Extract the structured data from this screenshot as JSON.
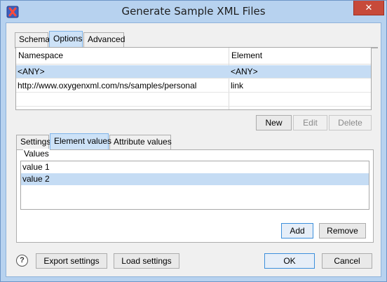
{
  "window": {
    "title": "Generate Sample XML Files",
    "close_glyph": "✕",
    "app_icon": "oxygen-x-icon"
  },
  "main_tabs": [
    {
      "label": "Schema",
      "active": false
    },
    {
      "label": "Options",
      "active": true
    },
    {
      "label": "Advanced",
      "active": false
    }
  ],
  "table": {
    "columns": [
      "Namespace",
      "Element"
    ],
    "rows": [
      {
        "namespace": "<ANY>",
        "element": "<ANY>",
        "selected": true
      },
      {
        "namespace": "http://www.oxygenxml.com/ns/samples/personal",
        "element": "link",
        "selected": false
      }
    ]
  },
  "table_buttons": {
    "new_label": "New",
    "edit_label": "Edit",
    "delete_label": "Delete"
  },
  "sub_tabs": [
    {
      "label": "Settings",
      "active": false
    },
    {
      "label": "Element values",
      "active": true
    },
    {
      "label": "Attribute values",
      "active": false
    }
  ],
  "values_group": {
    "label": "Values",
    "items": [
      {
        "label": "value 1",
        "selected": false
      },
      {
        "label": "value 2",
        "selected": true
      }
    ],
    "add_label": "Add",
    "remove_label": "Remove"
  },
  "footer": {
    "help_glyph": "?",
    "export_label": "Export settings",
    "load_label": "Load settings",
    "ok_label": "OK",
    "cancel_label": "Cancel"
  },
  "colors": {
    "selection": "#c5dcf4",
    "title_bar": "#b7d2ef",
    "close_button": "#c74a3a"
  }
}
